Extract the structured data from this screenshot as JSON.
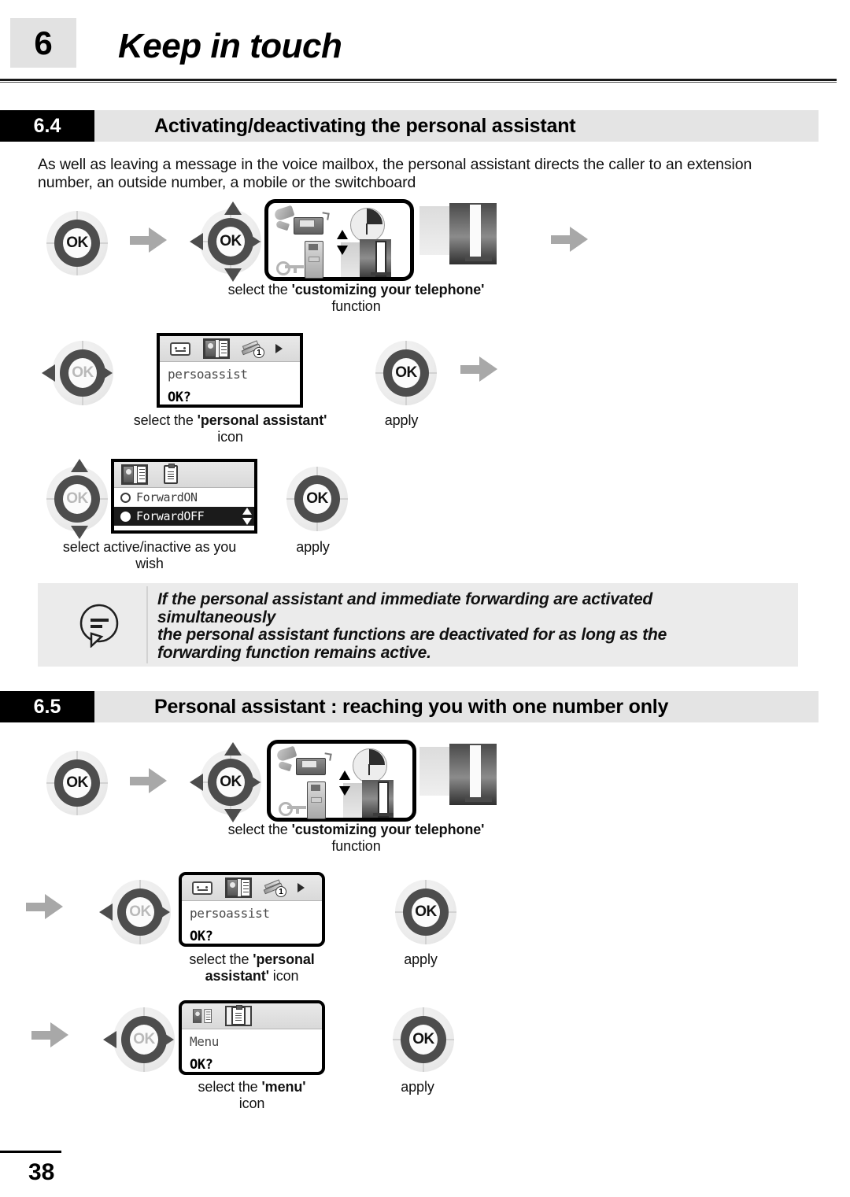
{
  "page": {
    "chapter_number": "6",
    "chapter_title": "Keep in touch",
    "page_number": "38"
  },
  "sections": [
    {
      "number": "6.4",
      "title": "Activating/deactivating the personal assistant",
      "intro": "As well as leaving a message in the voice mailbox, the personal assistant directs the caller to an extension number, an outside number, a mobile or the switchboard"
    },
    {
      "number": "6.5",
      "title": "Personal assistant : reaching you with one number only"
    }
  ],
  "captions": {
    "customizing_prefix": "select the ",
    "customizing_bold": "'customizing your telephone'",
    "customizing_suffix": "function",
    "persoassist_prefix": "select the ",
    "persoassist_bold": "'personal assistant'",
    "persoassist_suffix": "icon",
    "persoassist_bold_line1": "'personal",
    "persoassist_bold_line2": "assistant'",
    "persoassist_suffix2": " icon",
    "apply": "apply",
    "active_inactive_line1": "select active/inactive as you",
    "active_inactive_line2": "wish",
    "menu_prefix": "select the ",
    "menu_bold": "'menu'",
    "menu_suffix": "icon"
  },
  "lcd": {
    "persoassist": {
      "label": "persoassist",
      "confirm": "OK?",
      "tabs": [
        "cassette-icon",
        "personal-assistant-icon",
        "tools-icon"
      ],
      "tools_badge": "1",
      "selected_tab": "personal-assistant-icon"
    },
    "forward": {
      "tabs": [
        "personal-assistant-icon",
        "clipboard-icon"
      ],
      "selected_tab": "personal-assistant-icon",
      "items": [
        {
          "label": "ForwardON",
          "selected": false
        },
        {
          "label": "ForwardOFF",
          "selected": true
        }
      ]
    },
    "menu": {
      "label": "Menu",
      "confirm": "OK?",
      "tabs": [
        "personal-assistant-icon",
        "clipboard-icon"
      ],
      "selected_tab": "clipboard-icon"
    }
  },
  "note": {
    "line1": "If the personal assistant and immediate forwarding are activated",
    "line2": "simultaneously",
    "line3": "the personal assistant functions are deactivated for as long as the",
    "line4": "forwarding function remains active."
  },
  "keys": {
    "ok_label": "OK"
  },
  "colors": {
    "section_bar_bg": "#e4e4e4",
    "section_number_bg": "#000000",
    "note_bg": "#ebebeb",
    "arrow_gray": "#a8a8a8",
    "wheel_ring": "#4d4d4d"
  }
}
